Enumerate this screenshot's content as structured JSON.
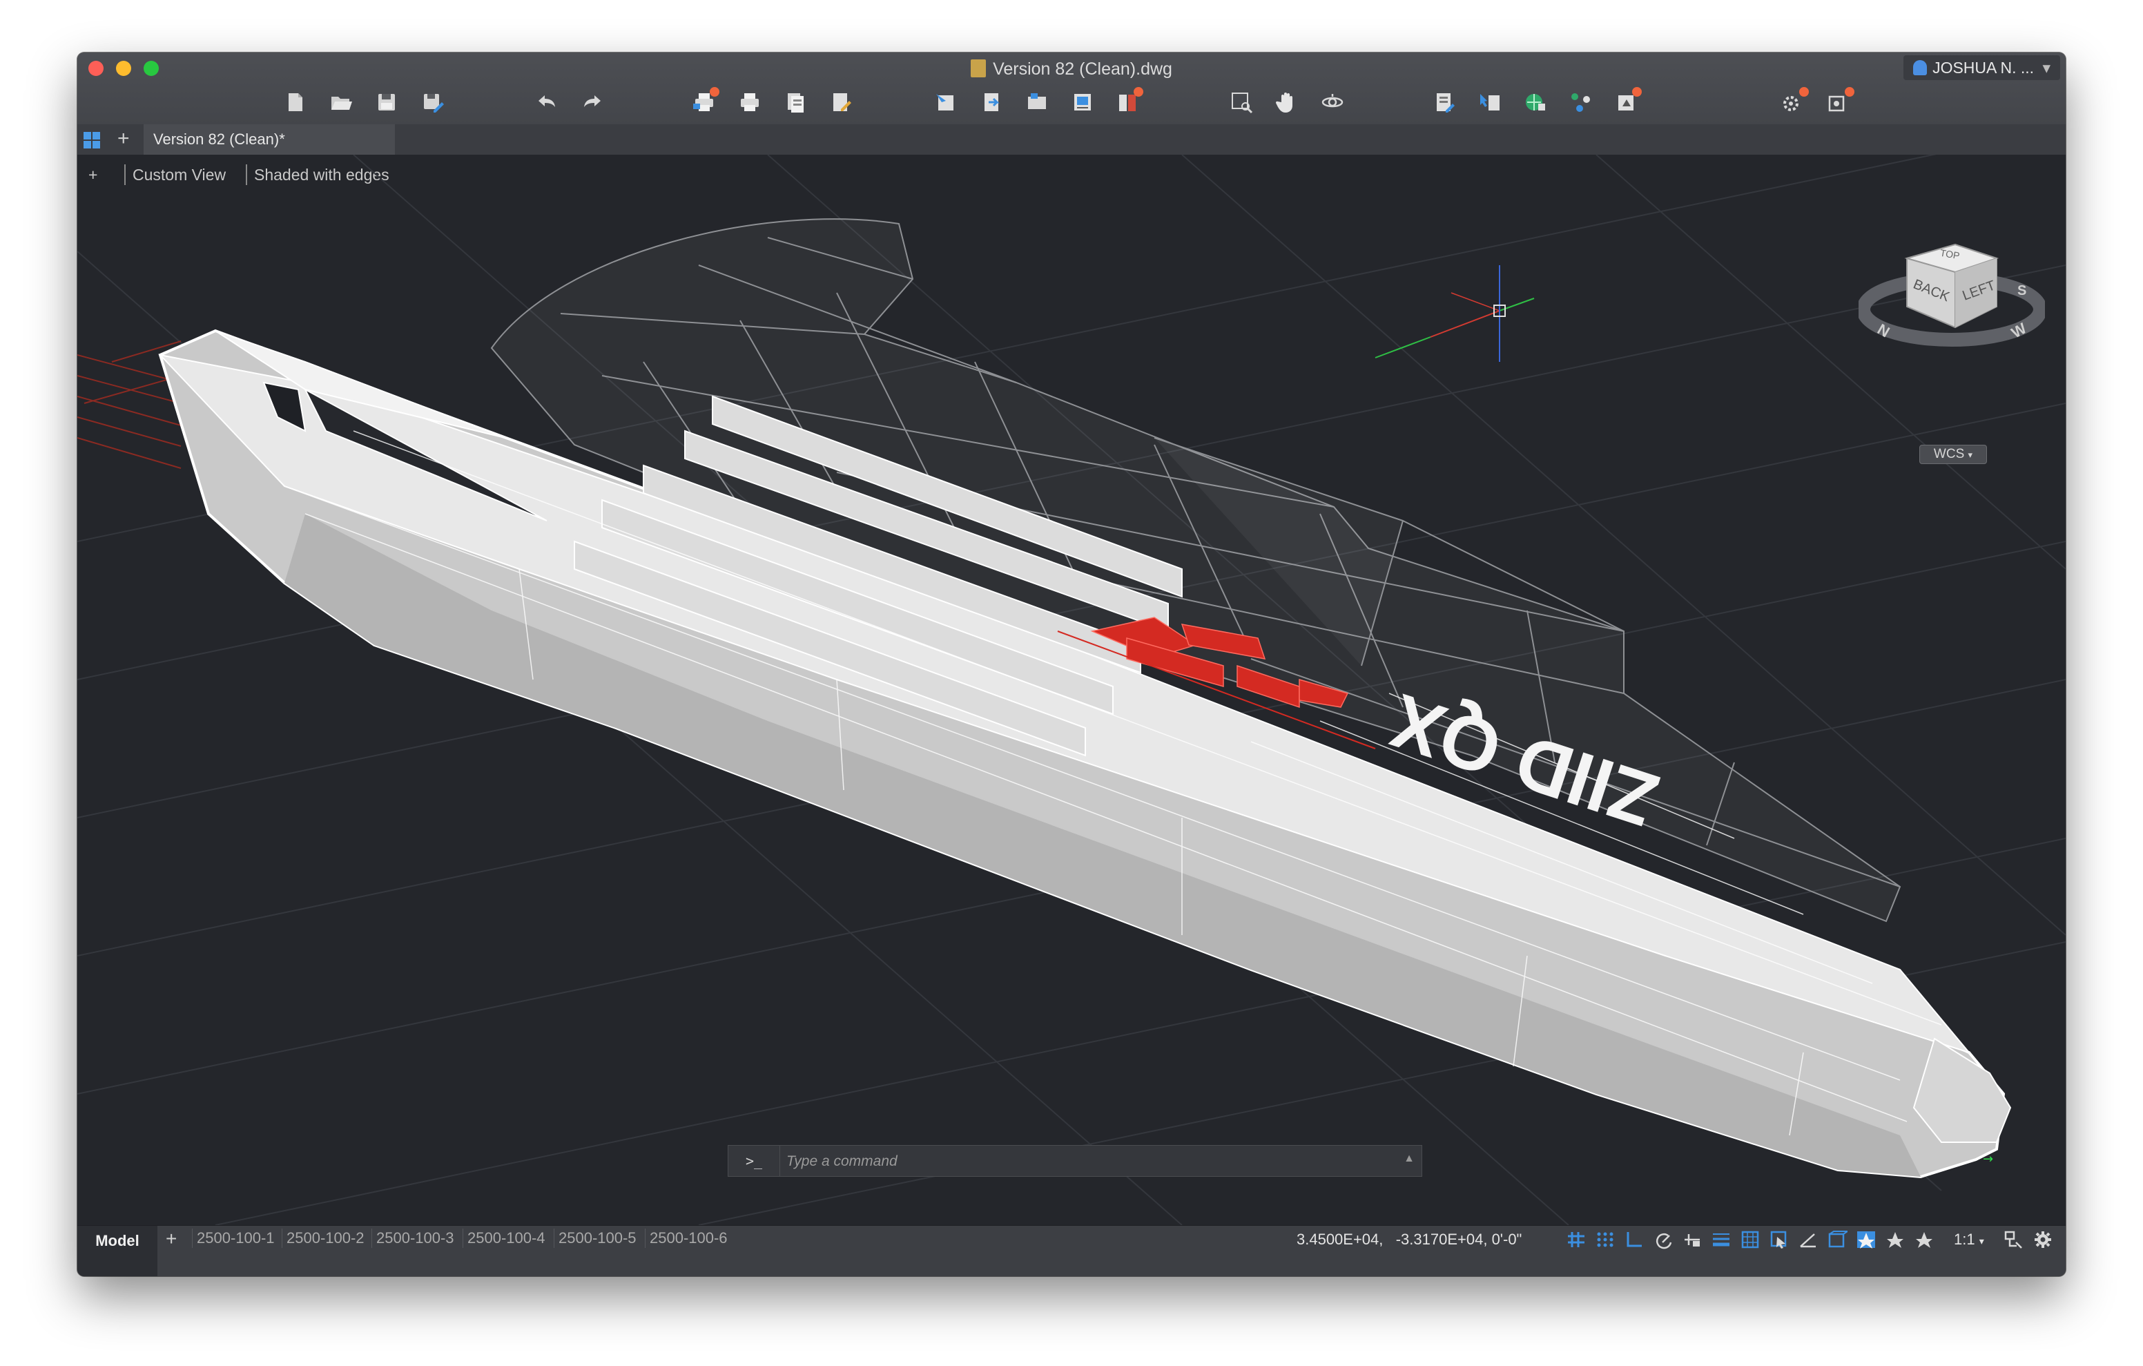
{
  "window": {
    "title": "Version 82 (Clean).dwg",
    "user": "JOSHUA N. ...",
    "user_chevron": "▾"
  },
  "toolbar": {
    "icons": [
      "new-file-icon",
      "open-folder-icon",
      "save-icon",
      "save-as-icon",
      "undo-icon",
      "redo-icon",
      "plot-icon",
      "print-icon",
      "publish-icon",
      "page-setup-icon",
      "insert-block-icon",
      "attach-icon",
      "xref-icon",
      "image-icon",
      "layer-icon",
      "zoom-window-icon",
      "pan-hand-icon",
      "orbit-icon",
      "properties-icon",
      "match-properties-icon",
      "hyperlink-icon",
      "share-icon",
      "render-icon",
      "settings-tools-icon",
      "help-icon"
    ]
  },
  "tabs": {
    "plus": "+",
    "document_tab": "Version 82 (Clean)*"
  },
  "viewport": {
    "view_menu": "+",
    "view_name": "Custom View",
    "visual_style": "Shaded with edges",
    "hull_text": "ZIID QX",
    "viewcube": {
      "face_back": "BACK",
      "face_left": "LEFT",
      "face_top": "TOP",
      "compass_n": "N",
      "compass_w": "W",
      "compass_s": "S"
    },
    "wcs_label": "WCS"
  },
  "command": {
    "prompt": ">_",
    "placeholder": "Type a command",
    "history_arrow": "▲"
  },
  "status": {
    "model_tab": "Model",
    "plus": "+",
    "layouts": [
      "2500-100-1",
      "2500-100-2",
      "2500-100-3",
      "2500-100-4",
      "2500-100-5",
      "2500-100-6"
    ],
    "coordinates": "3.4500E+04,   -3.3170E+04, 0'-0\"",
    "scale": "1:1",
    "scale_chevron": "▾"
  },
  "colors": {
    "accent_blue": "#3b8fe0",
    "highlight_red": "#d42a22",
    "hull_white": "#e6e6e6",
    "viewport_bg": "#24262b"
  }
}
